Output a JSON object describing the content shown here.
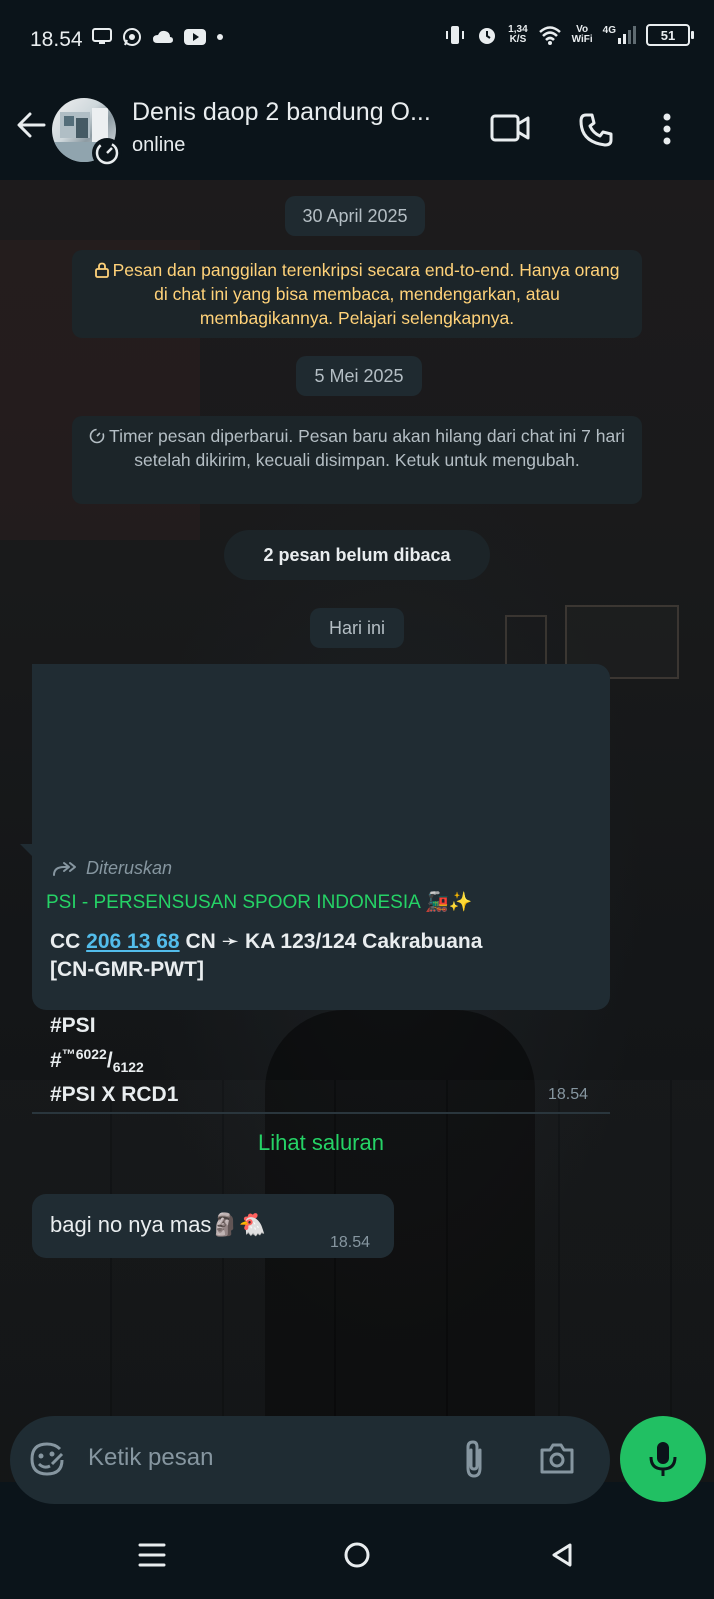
{
  "status_bar": {
    "time": "18.54",
    "net_speed_value": "1,34",
    "net_speed_unit": "K/S",
    "vowifi_top": "Vo",
    "vowifi_bottom": "WiFi",
    "network": "4G",
    "battery": "51"
  },
  "header": {
    "contact_name": "Denis daop 2 bandung O...",
    "status": "online"
  },
  "chat": {
    "date1": "30 April 2025",
    "encryption_notice": "Pesan dan panggilan terenkripsi secara end-to-end. Hanya orang di chat ini yang bisa membaca, mendengarkan, atau membagikannya. Pelajari selengkapnya.",
    "date2": "5 Mei 2025",
    "timer_notice": "Timer pesan diperbarui. Pesan baru akan hilang dari chat ini 7 hari setelah dikirim, kecuali disimpan. Ketuk untuk mengubah.",
    "unread": "2 pesan belum dibaca",
    "date3": "Hari ini",
    "forwarded_label": "Diteruskan",
    "forwarded_channel": "PSI - PERSENSUSAN SPOOR INDONESIA 🚂✨",
    "fwd_line1_prefix": "CC ",
    "fwd_line1_link": "206 13 68",
    "fwd_line1_suffix": " CN ➛ KA 123/124 Cakrabuana",
    "fwd_line2": "[CN-GMR-PWT]",
    "fwd_line3": "#PSI",
    "fwd_line4_prefix": "#",
    "fwd_line4_sup": "™6022",
    "fwd_line4_slash": "/",
    "fwd_line4_sub": "6122",
    "fwd_line5": "#PSI X RCD1",
    "fwd_time": "18.54",
    "view_channel": "Lihat saluran",
    "msg2_text": "bagi no nya mas🗿🐔",
    "msg2_time": "18.54"
  },
  "composer": {
    "placeholder": "Ketik pesan"
  },
  "colors": {
    "accent_green": "#21c063",
    "link_blue": "#53bdeb",
    "bubble": "#202c33",
    "system_text": "#ffd279"
  },
  "icons": [
    "back-arrow-icon",
    "video-call-icon",
    "phone-icon",
    "more-vert-icon",
    "lock-icon",
    "timer-icon",
    "forward-icon",
    "emoji-icon",
    "attach-icon",
    "camera-icon",
    "mic-icon",
    "nav-menu-icon",
    "nav-home-icon",
    "nav-back-icon"
  ]
}
